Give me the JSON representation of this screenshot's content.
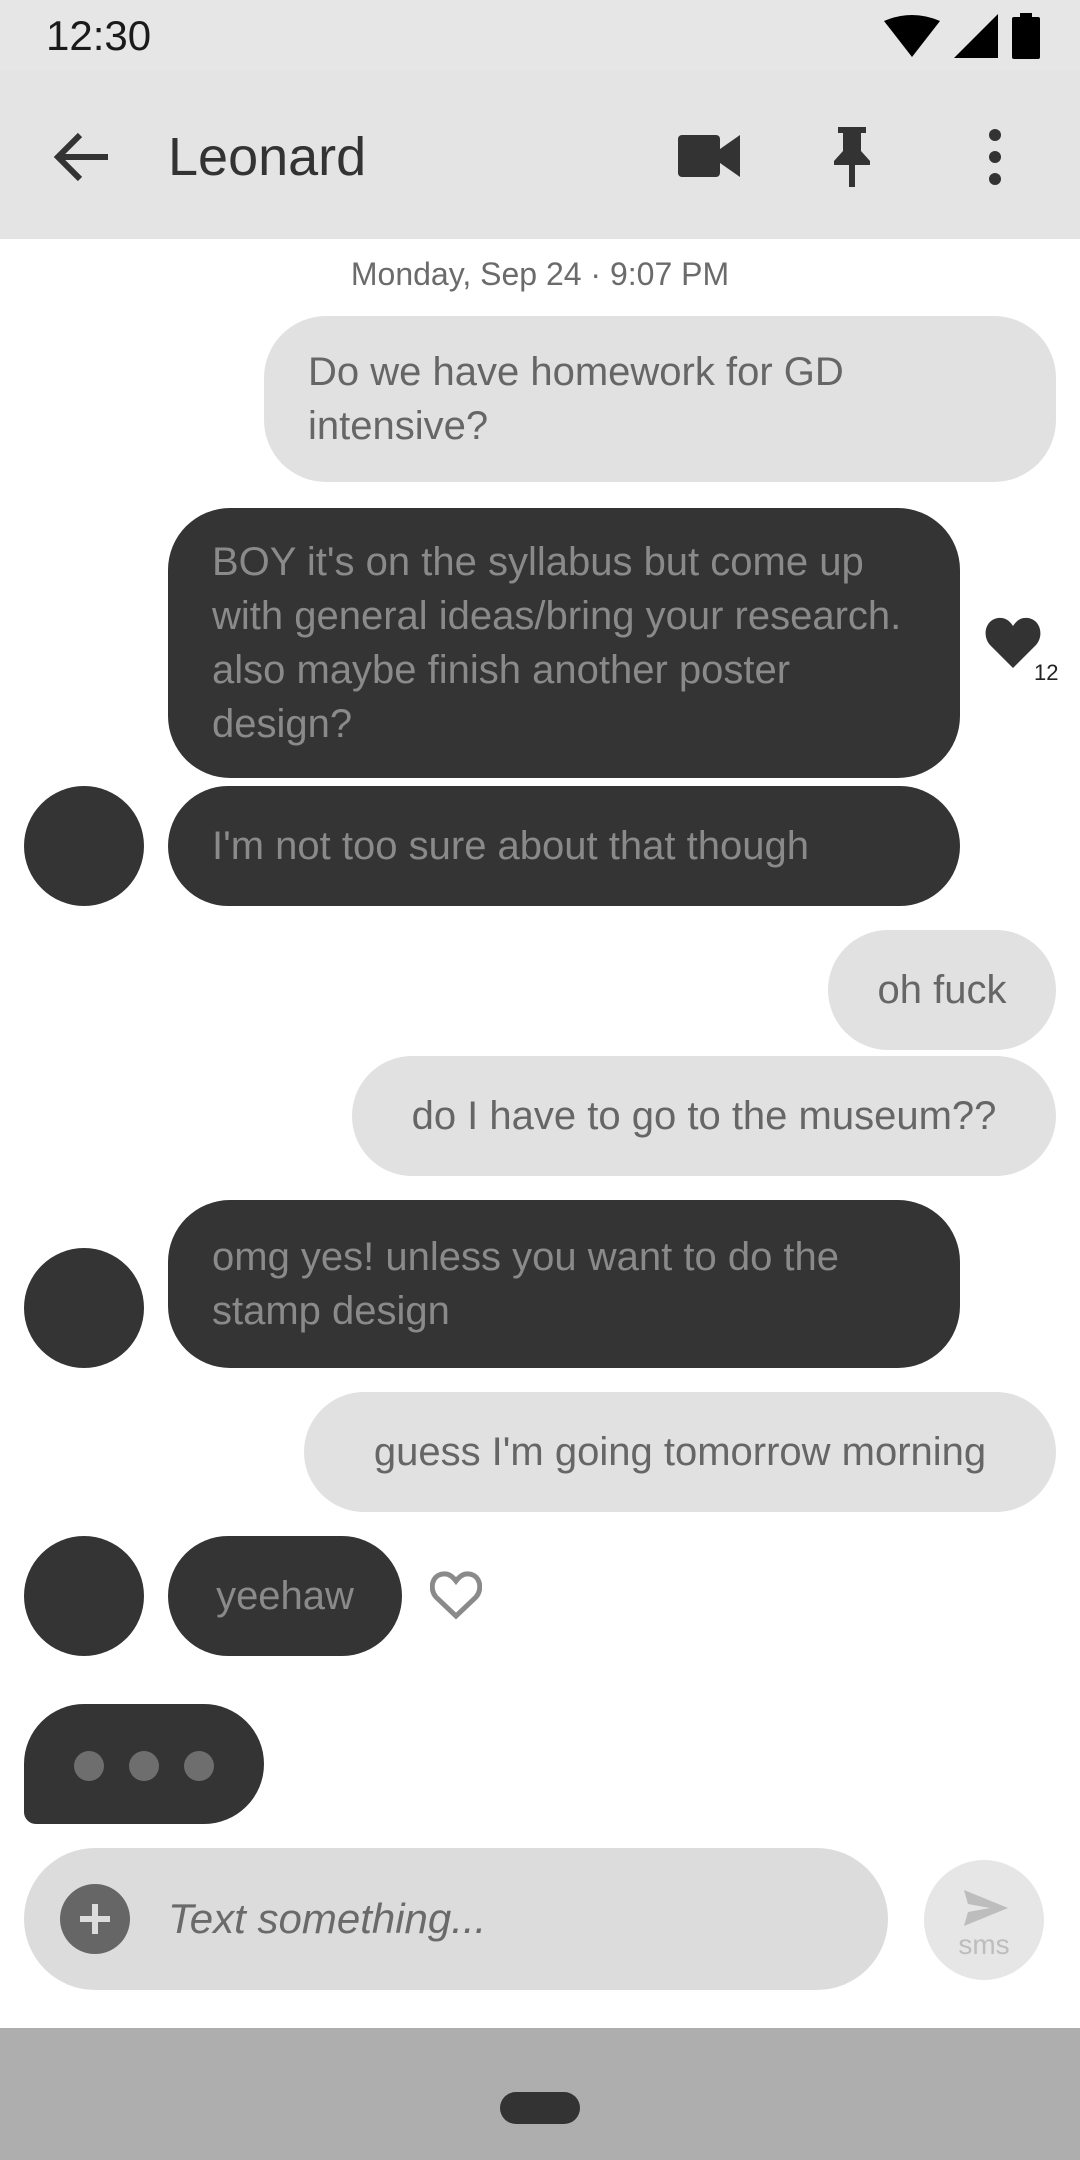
{
  "status_bar": {
    "time": "12:30",
    "icons": [
      "wifi-icon",
      "signal-icon",
      "battery-icon"
    ]
  },
  "app_bar": {
    "contact_name": "Leonard",
    "icons": [
      "back-arrow-icon",
      "video-camera-icon",
      "pin-icon",
      "more-vert-icon"
    ]
  },
  "chat": {
    "timestamp": "Monday, Sep 24 · 9:07 PM",
    "messages": [
      {
        "direction": "outgoing",
        "text": "Do we have homework for GD intensive?"
      },
      {
        "direction": "incoming",
        "text": "BOY it's on the syllabus but come up with general ideas/bring your research. also maybe finish another poster design?",
        "reaction": {
          "icon": "heart-filled-icon",
          "count": "12"
        }
      },
      {
        "direction": "incoming",
        "text": "I'm not too sure about that though"
      },
      {
        "direction": "outgoing",
        "text": "oh fuck"
      },
      {
        "direction": "outgoing",
        "text": "do I have to go to the museum??"
      },
      {
        "direction": "incoming",
        "text": "omg yes! unless you want to do the stamp design"
      },
      {
        "direction": "outgoing",
        "text": "guess I'm going tomorrow morning"
      },
      {
        "direction": "incoming",
        "text": "yeehaw",
        "reaction": {
          "icon": "heart-outline-icon"
        }
      }
    ],
    "typing_indicator": true
  },
  "composer": {
    "placeholder": "Text something...",
    "value": "",
    "send_label": "sms"
  },
  "colors": {
    "incoming_bubble": "#343434",
    "outgoing_bubble": "#e1e1e1",
    "app_bar": "#e4e4e4",
    "nav_bar": "#aeaeae"
  }
}
